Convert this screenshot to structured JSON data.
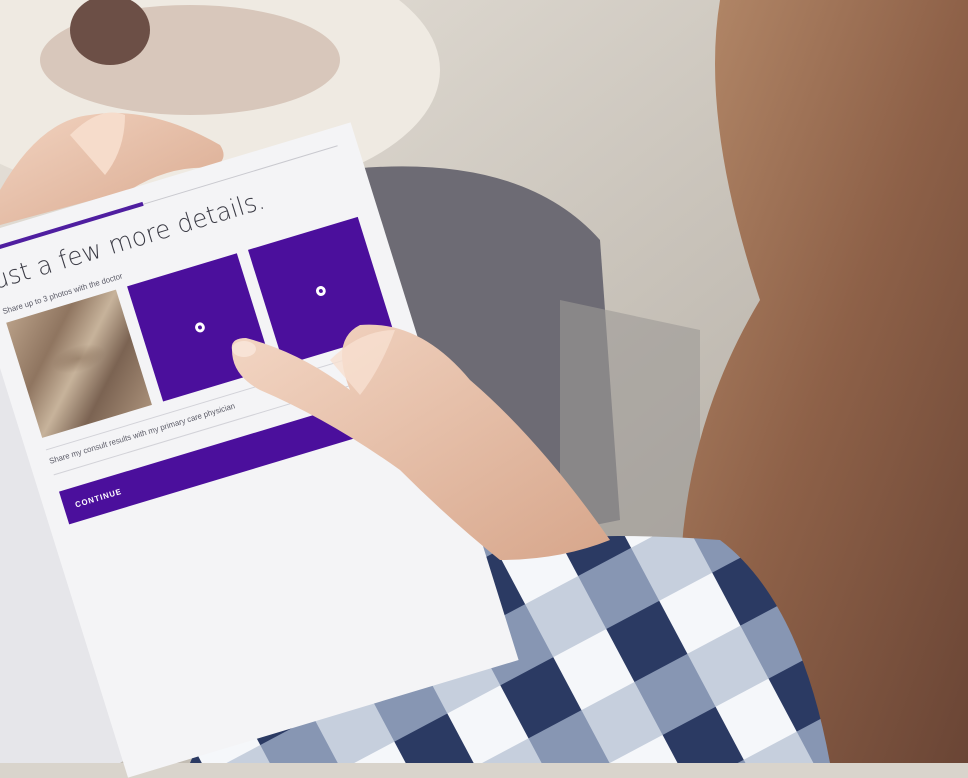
{
  "screen": {
    "progress_percent": 45,
    "title": "ust a few more details.",
    "photos_prompt": "Share up to 3 photos with the doctor",
    "photo_slots": [
      {
        "state": "photo",
        "icon": "skin-photo"
      },
      {
        "state": "empty",
        "icon": "add-photo-icon"
      },
      {
        "state": "empty",
        "icon": "add-photo-icon"
      }
    ],
    "share_option": "Share my consult results with my primary care physician",
    "continue_label": "CONTINUE"
  },
  "colors": {
    "accent": "#4b0f9c",
    "screen_background": "#f4f4f6",
    "tablet_frame": "#e6e6ea",
    "shirt_navy": "#2b3a63"
  }
}
